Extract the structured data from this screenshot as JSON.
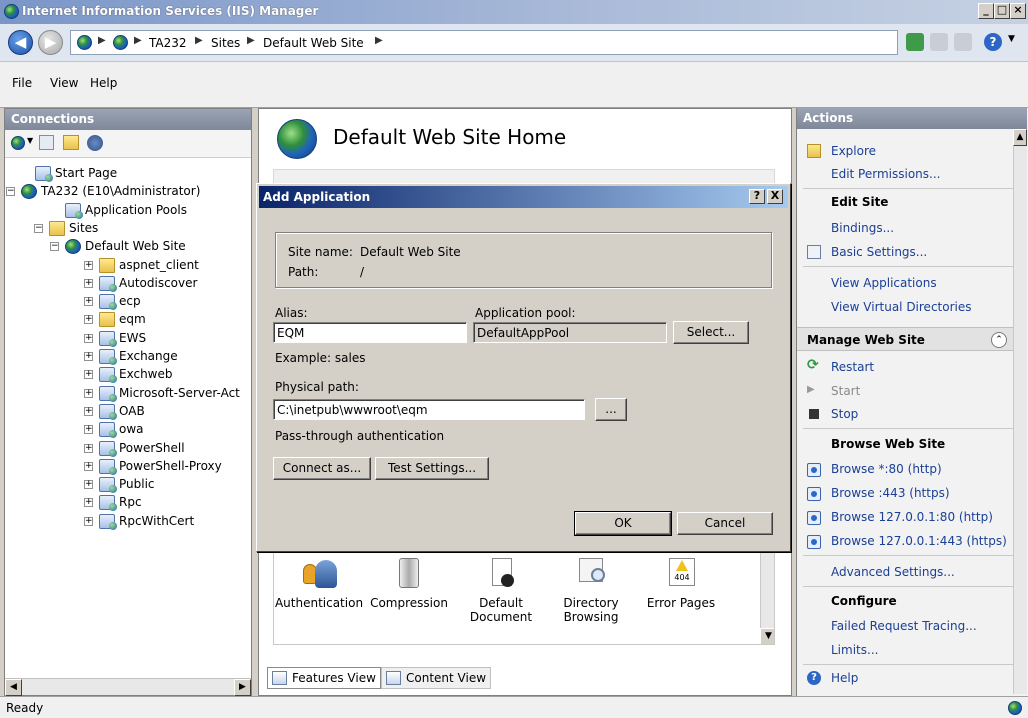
{
  "window": {
    "title": "Internet Information Services (IIS) Manager"
  },
  "address": {
    "crumbs": [
      "TA232",
      "Sites",
      "Default Web Site"
    ]
  },
  "menu": {
    "items": [
      "File",
      "View",
      "Help"
    ]
  },
  "connections": {
    "header": "Connections",
    "tree": [
      {
        "label": "Start Page"
      },
      {
        "label": "TA232 (E10\\Administrator)"
      },
      {
        "label": "Application Pools"
      },
      {
        "label": "Sites"
      },
      {
        "label": "Default Web Site"
      },
      {
        "label": "aspnet_client"
      },
      {
        "label": "Autodiscover"
      },
      {
        "label": "ecp"
      },
      {
        "label": "eqm"
      },
      {
        "label": "EWS"
      },
      {
        "label": "Exchange"
      },
      {
        "label": "Exchweb"
      },
      {
        "label": "Microsoft-Server-Act"
      },
      {
        "label": "OAB"
      },
      {
        "label": "owa"
      },
      {
        "label": "PowerShell"
      },
      {
        "label": "PowerShell-Proxy"
      },
      {
        "label": "Public"
      },
      {
        "label": "Rpc"
      },
      {
        "label": "RpcWithCert"
      }
    ]
  },
  "center": {
    "title": "Default Web Site Home",
    "features": [
      {
        "label": "Authentication",
        "icon": "authentication-icon"
      },
      {
        "label": "Compression",
        "icon": "compression-icon"
      },
      {
        "label": "Default\nDocument",
        "icon": "default-document-icon"
      },
      {
        "label": "Directory\nBrowsing",
        "icon": "directory-browsing-icon"
      },
      {
        "label": "Error Pages",
        "icon": "error-pages-icon",
        "badge": "404"
      }
    ],
    "tabs": {
      "features": "Features View",
      "content": "Content View"
    }
  },
  "actions": {
    "header": "Actions",
    "explore": "Explore",
    "edit_permissions": "Edit Permissions...",
    "edit_site_hdr": "Edit Site",
    "bindings": "Bindings...",
    "basic_settings": "Basic Settings...",
    "view_applications": "View Applications",
    "view_virtual_dirs": "View Virtual Directories",
    "manage_hdr": "Manage Web Site",
    "restart": "Restart",
    "start": "Start",
    "stop": "Stop",
    "browse_hdr": "Browse Web Site",
    "browse": [
      "Browse *:80 (http)",
      "Browse :443 (https)",
      "Browse 127.0.0.1:80 (http)",
      "Browse 127.0.0.1:443 (https)"
    ],
    "advanced_settings": "Advanced Settings...",
    "configure_hdr": "Configure",
    "failed_request": "Failed Request Tracing...",
    "limits": "Limits...",
    "help": "Help"
  },
  "status": {
    "text": "Ready"
  },
  "dialog": {
    "title": "Add Application",
    "help_btn": "?",
    "close_btn": "X",
    "site_name_label": "Site name:",
    "site_name_value": "Default Web Site",
    "path_label": "Path:",
    "path_value": "/",
    "alias_label": "Alias:",
    "alias_value": "EQM",
    "app_pool_label": "Application pool:",
    "app_pool_value": "DefaultAppPool",
    "select_btn": "Select...",
    "example": "Example: sales",
    "physical_path_label": "Physical path:",
    "physical_path_value": "C:\\inetpub\\wwwroot\\eqm",
    "browse_btn": "...",
    "passthrough": "Pass-through authentication",
    "connect_as_btn": "Connect as...",
    "test_settings_btn": "Test Settings...",
    "ok_btn": "OK",
    "cancel_btn": "Cancel"
  },
  "colors": {
    "link": "#1a3f94",
    "title_gradient_start": "#0a246a"
  }
}
